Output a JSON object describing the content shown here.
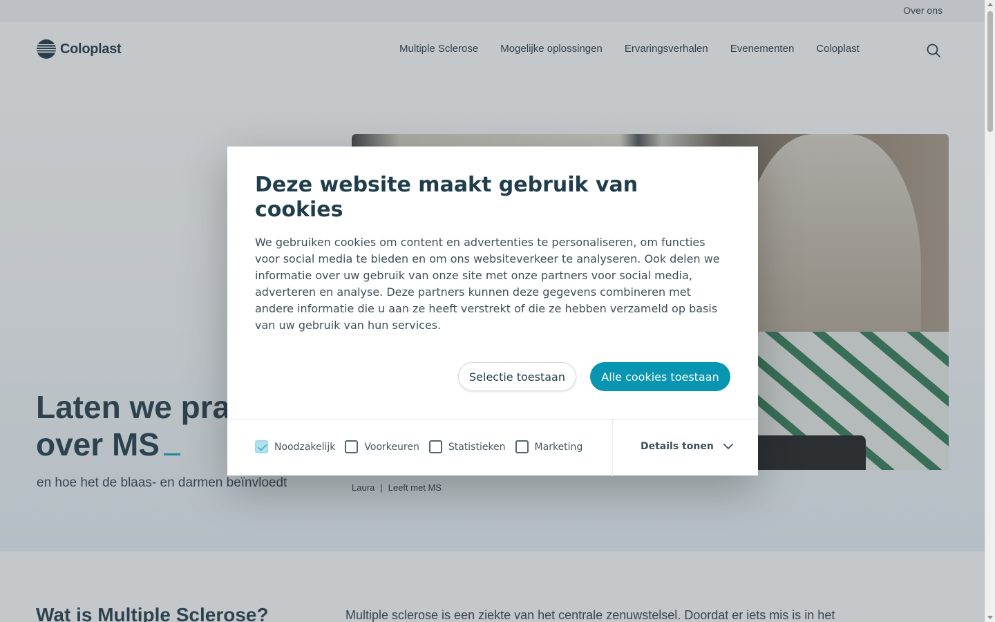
{
  "utility": {
    "about_link": "Over ons"
  },
  "header": {
    "logo_text": "Coloplast",
    "nav": [
      {
        "label": "Multiple Sclerose"
      },
      {
        "label": "Mogelijke oplossingen"
      },
      {
        "label": "Ervaringsverhalen"
      },
      {
        "label": "Evenementen"
      },
      {
        "label": "Coloplast"
      }
    ],
    "search_icon": "search-icon"
  },
  "hero": {
    "title_line1": "Laten we prat",
    "title_line2": "over MS",
    "subtitle": "en hoe het de blaas- en darmen beïnvloedt",
    "caption_name": "Laura",
    "caption_separator": "|",
    "caption_role": "Leeft met MS"
  },
  "section": {
    "title": "Wat is Multiple Sclerose?",
    "text": "Multiple sclerose is een ziekte van het centrale zenuwstelsel. Doordat er iets mis is in het"
  },
  "cookie_dialog": {
    "title": "Deze website maakt gebruik van cookies",
    "body": "We gebruiken cookies om content en advertenties te personaliseren, om functies voor social media te bieden en om ons websiteverkeer te analyseren. Ook delen we informatie over uw gebruik van onze site met onze partners voor social media, adverteren en analyse. Deze partners kunnen deze gegevens combineren met andere informatie die u aan ze heeft verstrekt of die ze hebben verzameld op basis van uw gebruik van hun services.",
    "allow_selection": "Selectie toestaan",
    "allow_all": "Alle cookies toestaan",
    "consents": [
      {
        "label": "Noodzakelijk",
        "checked": true
      },
      {
        "label": "Voorkeuren",
        "checked": false
      },
      {
        "label": "Statistieken",
        "checked": false
      },
      {
        "label": "Marketing",
        "checked": false
      }
    ],
    "details_label": "Details tonen",
    "details_icon": "chevron-down-icon"
  },
  "colors": {
    "accent": "#0795b2",
    "heading": "#1f3d4a",
    "cursor": "#00a3b4",
    "overlay": "rgba(80, 88, 96, 0.33)"
  }
}
